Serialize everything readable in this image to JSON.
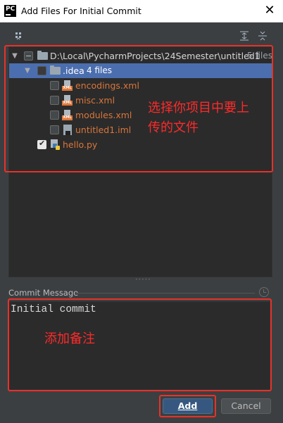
{
  "window": {
    "app_icon_text": "PC",
    "title": "Add Files For Initial Commit",
    "close_glyph": "✕"
  },
  "toolbar": {
    "group_icon": "group-by-icon",
    "expand_all_icon": "expand-all-icon",
    "collapse_all_icon": "collapse-all-icon"
  },
  "tree": {
    "root": {
      "path": "D:\\Local\\PycharmProjects\\24Semester\\untitled1",
      "meta": "5 files"
    },
    "idea": {
      "name": ".idea",
      "meta": "4 files"
    },
    "files": [
      {
        "name": "encodings.xml"
      },
      {
        "name": "misc.xml"
      },
      {
        "name": "modules.xml"
      },
      {
        "name": "untitled1.iml"
      }
    ],
    "hello": {
      "name": "hello.py"
    }
  },
  "annotations": {
    "tree_note_line1": "选择你项目中要上",
    "tree_note_line2": "传的文件",
    "commit_note": "添加备注"
  },
  "commit": {
    "label": "Commit Message",
    "message": "Initial commit"
  },
  "buttons": {
    "add": "Add",
    "cancel": "Cancel"
  },
  "colors": {
    "background": "#3c3f41",
    "panel": "#2b2b2b",
    "selection": "#4b6eaf",
    "unversioned_file": "#d9763b",
    "annotation": "#e8312a",
    "default_button": "#365880"
  }
}
